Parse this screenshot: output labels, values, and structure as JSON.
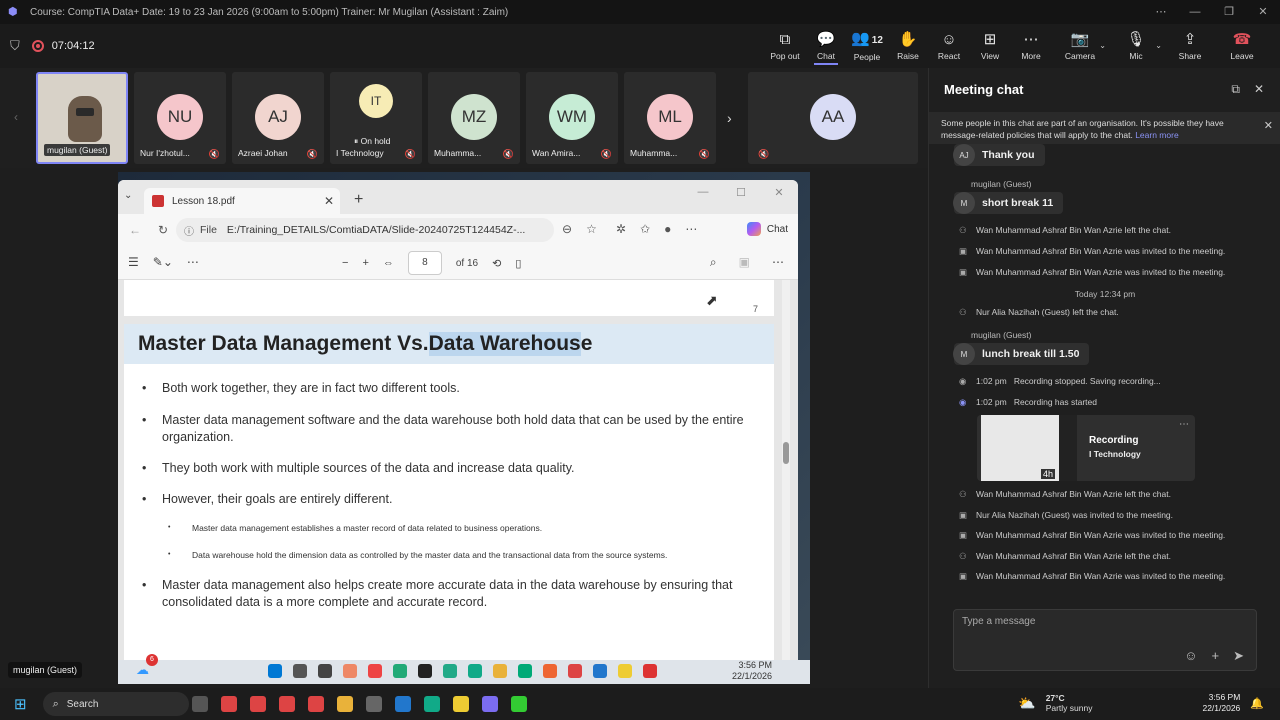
{
  "titlebar": {
    "text": "Course: CompTIA Data+ Date: 19 to 23 Jan 2026 (9:00am to 5:00pm) Trainer: Mr Mugilan (Assistant : Zaim)"
  },
  "meeting_toolbar": {
    "timer": "07:04:12",
    "buttons": [
      {
        "label": "Pop out",
        "icon": "pop-out-icon"
      },
      {
        "label": "Chat",
        "icon": "chat-icon"
      },
      {
        "label": "People",
        "icon": "people-icon",
        "count": "12"
      },
      {
        "label": "Raise",
        "icon": "hand-icon"
      },
      {
        "label": "React",
        "icon": "smile-icon"
      },
      {
        "label": "View",
        "icon": "grid-icon"
      },
      {
        "label": "More",
        "icon": "ellipsis-icon"
      },
      {
        "label": "Camera",
        "icon": "camera-off-icon"
      },
      {
        "label": "Mic",
        "icon": "mic-off-icon"
      },
      {
        "label": "Share",
        "icon": "share-icon"
      },
      {
        "label": "Leave",
        "icon": "phone-icon"
      }
    ]
  },
  "participants": [
    {
      "name": "mugilan (Guest)",
      "initials": "",
      "color": ""
    },
    {
      "name": "Nur I'zhotul...",
      "initials": "NU",
      "color": "#f5c6cb"
    },
    {
      "name": "Azraei Johan",
      "initials": "AJ",
      "color": "#f1d5cf"
    },
    {
      "name": "I Technology",
      "initials": "IT",
      "color": "#f7ecb5",
      "status": "On hold"
    },
    {
      "name": "Muhamma...",
      "initials": "MZ",
      "color": "#cfe3cf"
    },
    {
      "name": "Wan Amira...",
      "initials": "WM",
      "color": "#c6ecd5"
    },
    {
      "name": "Muhamma...",
      "initials": "ML",
      "color": "#f5c6cb"
    },
    {
      "name": "",
      "initials": "AA",
      "color": "#d9dcf5"
    }
  ],
  "browser": {
    "tab_title": "Lesson 18.pdf",
    "address_prefix": "File",
    "address": "E:/Training_DETAILS/ComtiaDATA/Slide-20240725T124454Z-...",
    "copilot_label": "Chat",
    "page_number": "8",
    "page_total": "of 16"
  },
  "pdf": {
    "page_no": "7",
    "heading_plain": "Master Data Management Vs. ",
    "heading_highlight": "Data Warehous",
    "heading_tail": "e",
    "bullets": [
      "Both work together, they are in fact two different tools.",
      "Master data management software and the data warehouse both hold data that can be used by the entire organization.",
      "They both work with multiple sources of the data and increase data quality.",
      "However, their goals are entirely different."
    ],
    "sub_bullets": [
      "Master data management establishes a master record of data related to business operations.",
      "Data warehouse hold the dimension data as controlled by the master data and the transactional data from the source systems."
    ],
    "last_bullet": "Master data management also helps create more accurate data in the data warehouse by ensuring that consolidated data is a more complete and accurate record."
  },
  "shared_taskbar": {
    "time": "3:56 PM",
    "date": "22/1/2026",
    "badge": "6"
  },
  "presenter_label": "mugilan (Guest)",
  "chat": {
    "title": "Meeting chat",
    "notice": "Some people in this chat are part of an organisation. It's possible they have message-related policies that will apply to the chat.",
    "learn_more": "Learn more",
    "messages": {
      "m1_text": "Thank you",
      "m1_av": "AJ",
      "m2_sender": "mugilan (Guest)",
      "m2_text": "short break 11",
      "m2_av": "M",
      "e1": "Wan Muhammad Ashraf Bin Wan Azrie left the chat.",
      "e2": "Wan Muhammad Ashraf Bin Wan Azrie was invited to the meeting.",
      "e3": "Wan Muhammad Ashraf Bin Wan Azrie was invited to the meeting.",
      "day": "Today 12:34 pm",
      "e4": "Nur Alia Nazihah (Guest) left the chat.",
      "m3_sender": "mugilan (Guest)",
      "m3_text": "lunch break till 1.50",
      "m3_av": "M",
      "r1_time": "1:02 pm",
      "r1_text": "Recording stopped. Saving recording...",
      "r2_time": "1:02 pm",
      "r2_text": "Recording has started",
      "card_title": "Recording",
      "card_sub": "I Technology",
      "card_dur": "4h",
      "e5": "Wan Muhammad Ashraf Bin Wan Azrie left the chat.",
      "e6": "Nur Alia Nazihah (Guest) was invited to the meeting.",
      "e7": "Wan Muhammad Ashraf Bin Wan Azrie was invited to the meeting.",
      "e8": "Wan Muhammad Ashraf Bin Wan Azrie left the chat.",
      "e9": "Wan Muhammad Ashraf Bin Wan Azrie was invited to the meeting."
    },
    "compose_placeholder": "Type a message"
  },
  "taskbar": {
    "search_label": "Search",
    "temp": "27°C",
    "weather": "Partly sunny",
    "time": "3:56 PM",
    "date": "22/1/2026"
  }
}
